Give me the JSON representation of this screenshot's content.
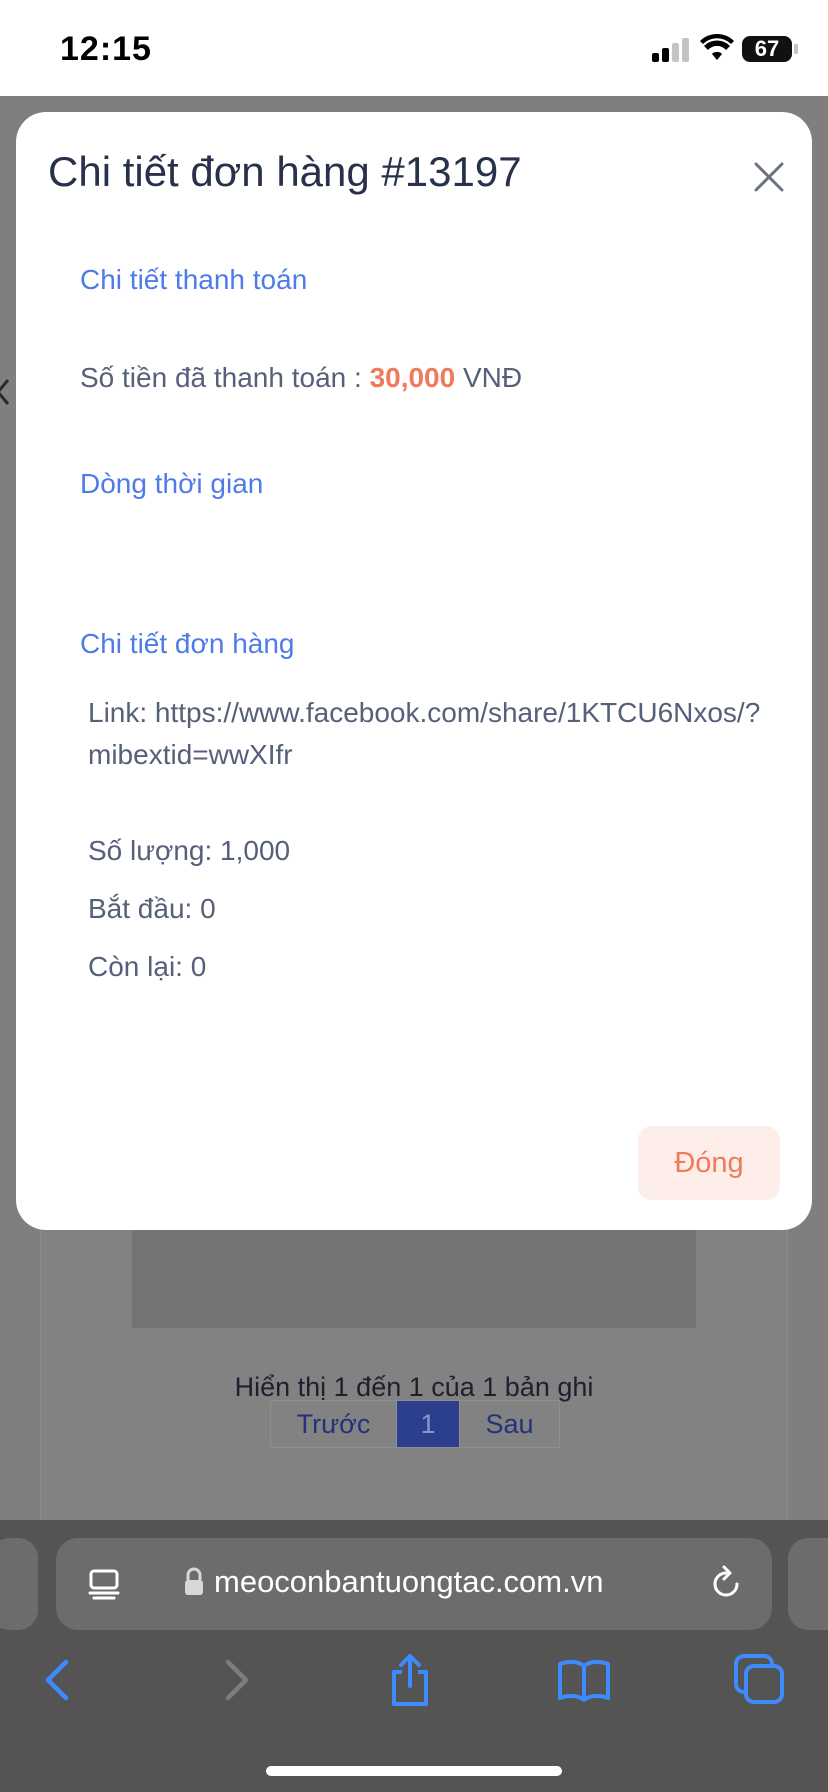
{
  "status_bar": {
    "time": "12:15",
    "battery": "67"
  },
  "background": {
    "pagination_info": "Hiển thị 1 đến 1 của 1 bản ghi",
    "pagination": {
      "prev": "Trước",
      "current": "1",
      "next": "Sau"
    }
  },
  "modal": {
    "title": "Chi tiết đơn hàng #13197",
    "payment_section": {
      "title": "Chi tiết thanh toán",
      "paid_label": "Số tiền đã thanh toán :",
      "paid_amount": "30,000",
      "currency": "VNĐ"
    },
    "timeline_section": {
      "title": "Dòng thời gian"
    },
    "order_section": {
      "title": "Chi tiết đơn hàng",
      "link": "Link: https://www.facebook.com/share/1KTCU6Nxos/?mibextid=wwXIfr",
      "quantity": "Số lượng: 1,000",
      "start": "Bắt đầu: 0",
      "remaining": "Còn lại: 0"
    },
    "close_button": "Đóng"
  },
  "browser": {
    "url": "meoconbantuongtac.com.vn"
  },
  "colors": {
    "accent_blue": "#4f7be8",
    "amount_orange": "#f07a5a",
    "ios_blue": "#3d8bff"
  },
  "icons": [
    "close-icon",
    "reader-icon",
    "lock-icon",
    "reload-icon",
    "back-icon",
    "forward-icon",
    "share-icon",
    "bookmarks-icon",
    "tabs-icon",
    "wifi-icon",
    "signal-icon",
    "battery-icon"
  ]
}
